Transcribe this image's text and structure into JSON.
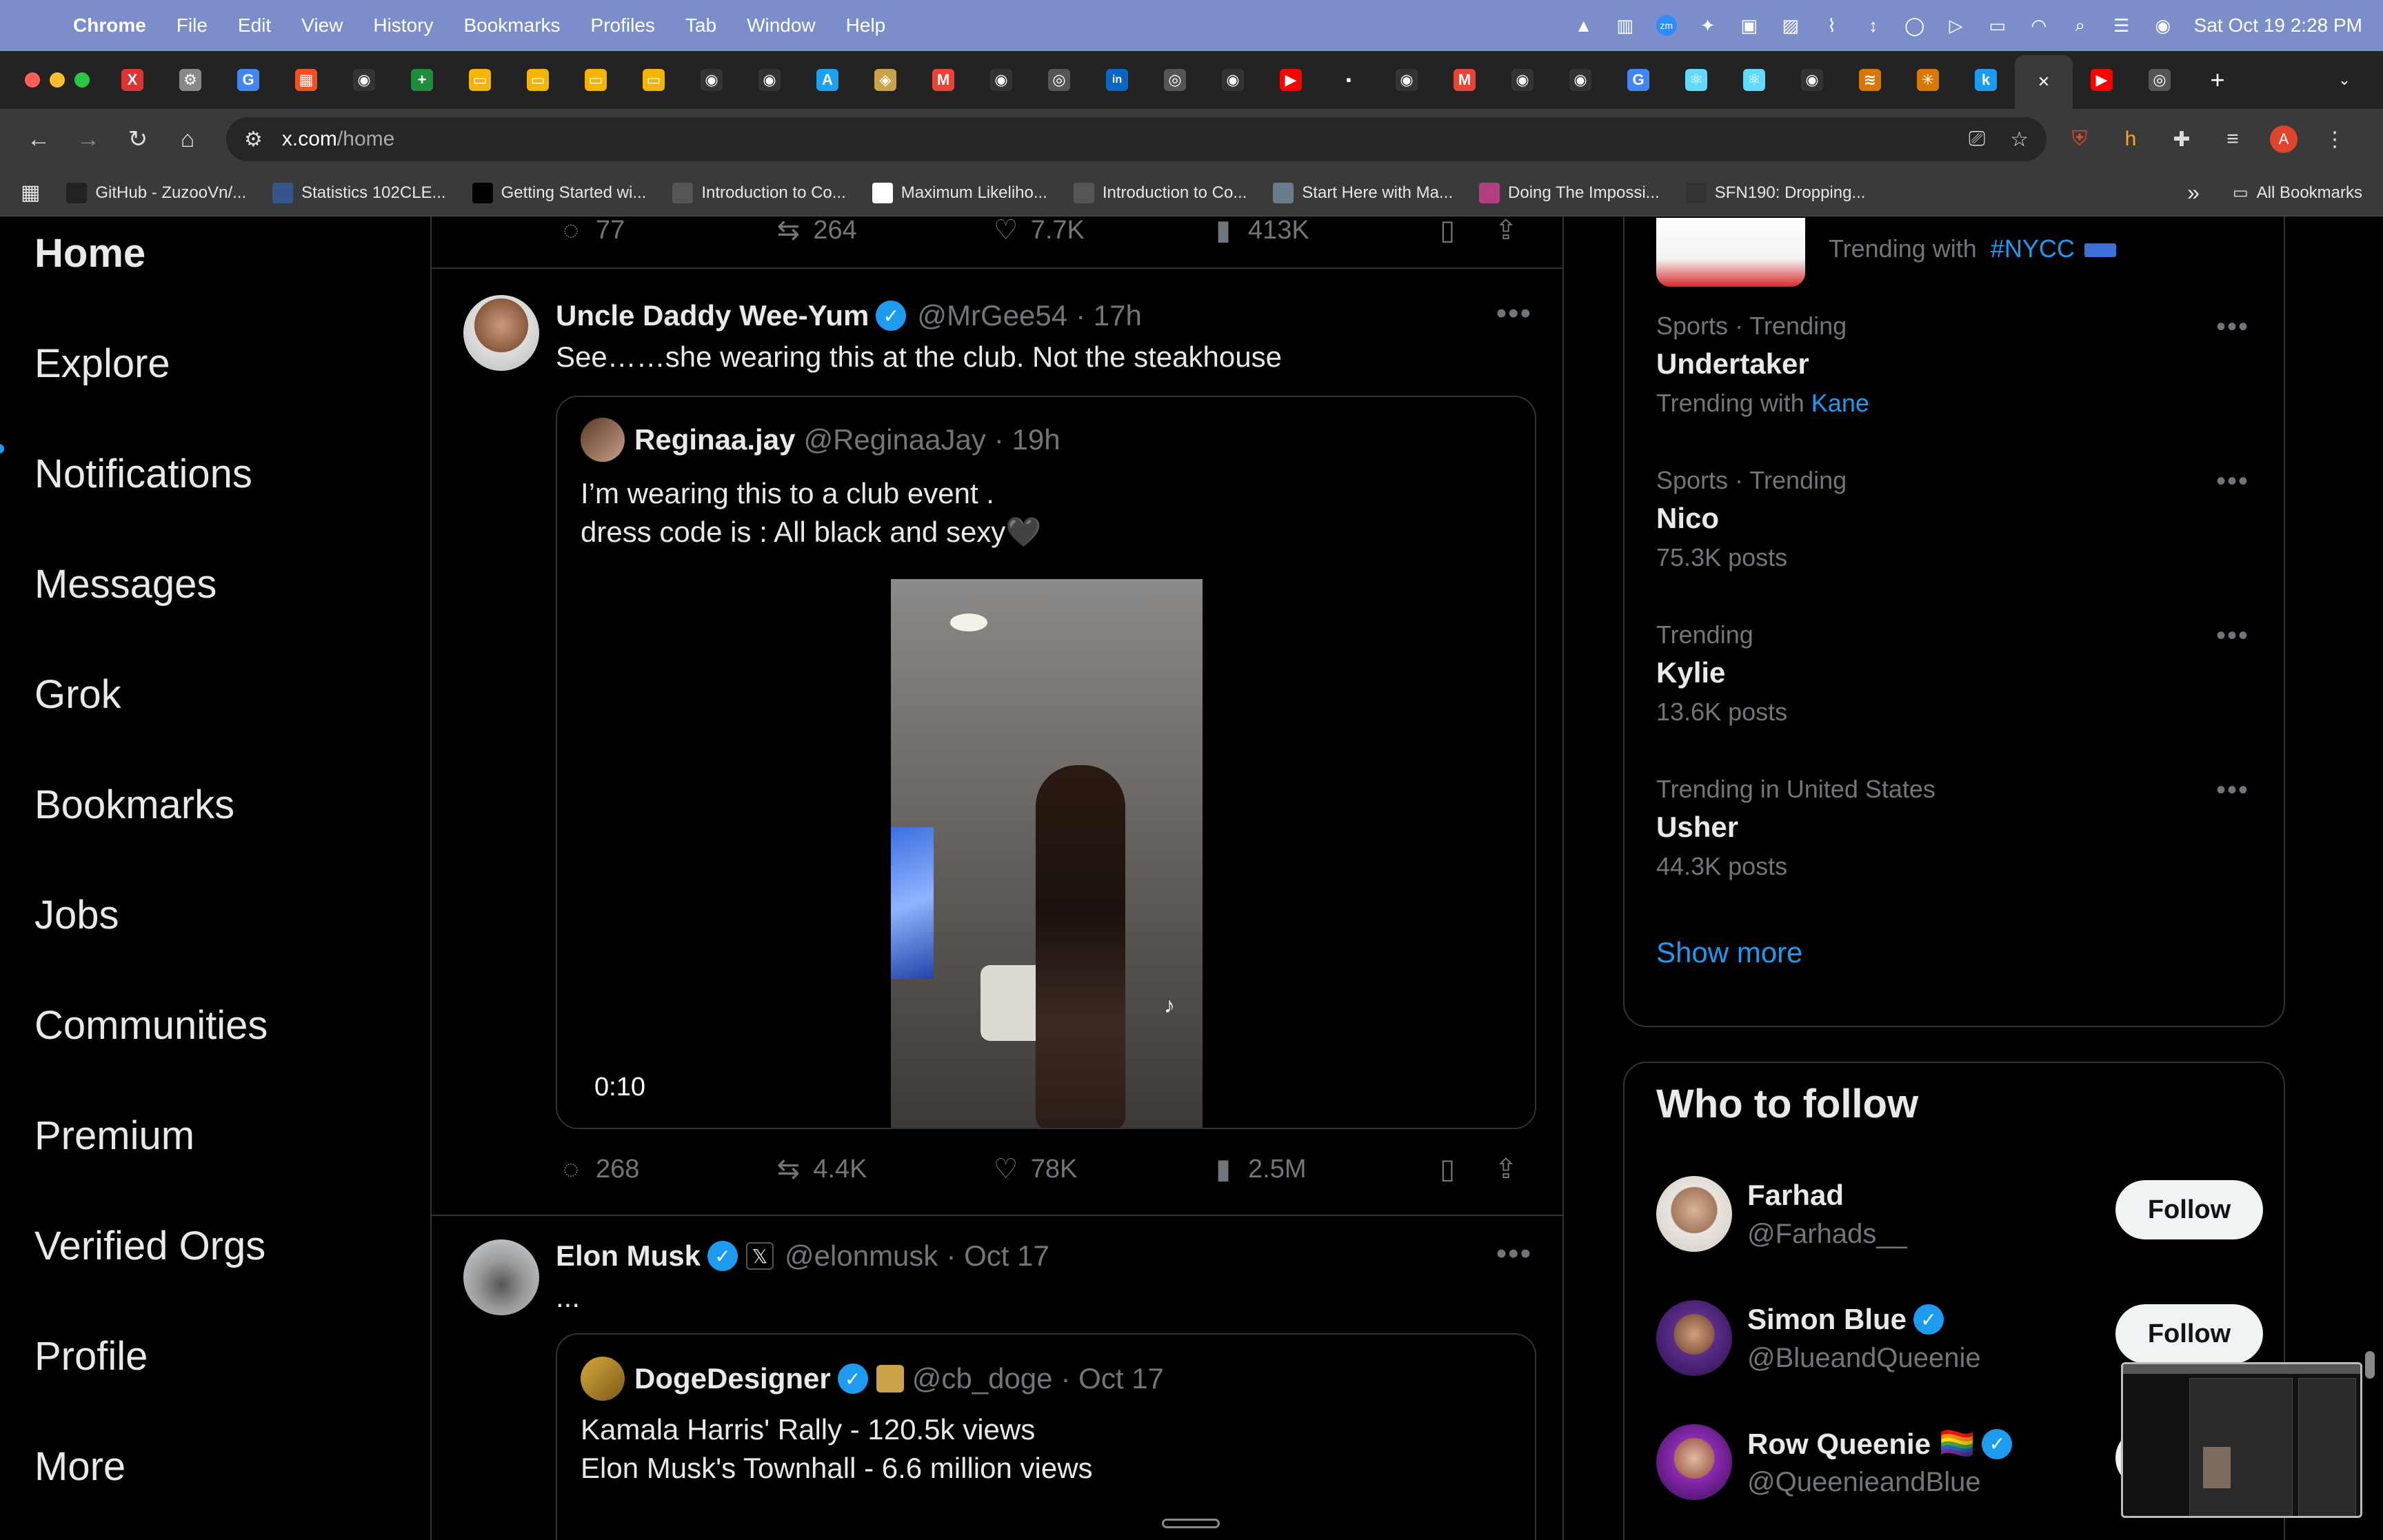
{
  "menubar": {
    "app": "Chrome",
    "items": [
      "File",
      "Edit",
      "View",
      "History",
      "Bookmarks",
      "Profiles",
      "Tab",
      "Window",
      "Help"
    ],
    "clock": "Sat Oct 19  2:28 PM"
  },
  "tabs": {
    "favicons": [
      "X",
      "⚙",
      "G",
      "▦",
      "◉",
      "+",
      "▭",
      "▭",
      "▭",
      "▭",
      "◉",
      "◉",
      "A",
      "◈",
      "M",
      "◉",
      "◎",
      "in",
      "◎",
      "◉",
      "▶",
      "▪",
      "◉",
      "M",
      "◉",
      "◉",
      "G",
      "⚛",
      "⚛",
      "◉",
      "≋",
      "✳",
      "k",
      "✕",
      "▶",
      "◎"
    ],
    "new_tab": "+",
    "overflow": "⌄"
  },
  "address": {
    "host": "x.com",
    "path": "/home"
  },
  "bookmarks": {
    "items": [
      {
        "label": "GitHub - ZuzooVn/...",
        "icon": "github-icon"
      },
      {
        "label": "Statistics 102CLE...",
        "icon": "stats-icon"
      },
      {
        "label": "Getting Started wi...",
        "icon": "medium-icon"
      },
      {
        "label": "Introduction to Co...",
        "icon": "course-icon"
      },
      {
        "label": "Maximum Likeliho...",
        "icon": "doc-icon"
      },
      {
        "label": "Introduction to Co...",
        "icon": "course-icon"
      },
      {
        "label": "Start Here with Ma...",
        "icon": "image-icon"
      },
      {
        "label": "Doing The Impossi...",
        "icon": "globe-icon"
      },
      {
        "label": "SFN190: Dropping...",
        "icon": "f-icon"
      }
    ],
    "more": "»",
    "all": "All Bookmarks"
  },
  "nav": {
    "items": [
      "Home",
      "Explore",
      "Notifications",
      "Messages",
      "Grok",
      "Bookmarks",
      "Jobs",
      "Communities",
      "Premium",
      "Verified Orgs",
      "Profile",
      "More"
    ]
  },
  "top_actions": {
    "replies": "77",
    "reposts": "264",
    "likes": "7.7K",
    "views": "413K"
  },
  "tweet1": {
    "name": "Uncle Daddy Wee-Yum",
    "handle": "@MrGee54",
    "time": "· 17h",
    "text": "See……she wearing this at the club. Not the steakhouse",
    "quote": {
      "name": "Reginaa.jay",
      "handle": "@ReginaaJay",
      "time": "· 19h",
      "line1": "I’m wearing this to a club event .",
      "line2": "dress code is : All black and sexy🖤",
      "duration": "0:10"
    },
    "actions": {
      "replies": "268",
      "reposts": "4.4K",
      "likes": "78K",
      "views": "2.5M"
    }
  },
  "tweet2": {
    "name": "Elon Musk",
    "handle": "@elonmusk",
    "time": "· Oct 17",
    "text": "...",
    "quote": {
      "name": "DogeDesigner",
      "handle": "@cb_doge",
      "time": "· Oct 17",
      "line1": "Kamala Harris' Rally - 120.5k views",
      "line2": "Elon Musk's Townhall - 6.6 million views"
    }
  },
  "trends": {
    "first_sub": "Trending with",
    "first_link": "#NYCC",
    "items": [
      {
        "context": "Sports · Trending",
        "title": "Undertaker",
        "sub_prefix": "Trending with",
        "sub_link": "Kane",
        "sub": ""
      },
      {
        "context": "Sports · Trending",
        "title": "Nico",
        "sub_prefix": "",
        "sub_link": "",
        "sub": "75.3K posts"
      },
      {
        "context": "Trending",
        "title": "Kylie",
        "sub_prefix": "",
        "sub_link": "",
        "sub": "13.6K posts"
      },
      {
        "context": "Trending in United States",
        "title": "Usher",
        "sub_prefix": "",
        "sub_link": "",
        "sub": "44.3K posts"
      }
    ],
    "show_more": "Show more"
  },
  "who_to_follow": {
    "title": "Who to follow",
    "button": "Follow",
    "people": [
      {
        "name": "Farhad",
        "handle": "@Farhads__",
        "verified": false,
        "flag": ""
      },
      {
        "name": "Simon Blue",
        "handle": "@BlueandQueenie",
        "verified": true,
        "flag": ""
      },
      {
        "name": "Row Queenie",
        "handle": "@QueenieandBlue",
        "verified": true,
        "flag": "🏳️‍🌈"
      }
    ]
  },
  "colors": {
    "accent": "#1d9bf0",
    "border": "#2f3336",
    "muted": "#71767b",
    "menubar": "#7b8ec9"
  }
}
